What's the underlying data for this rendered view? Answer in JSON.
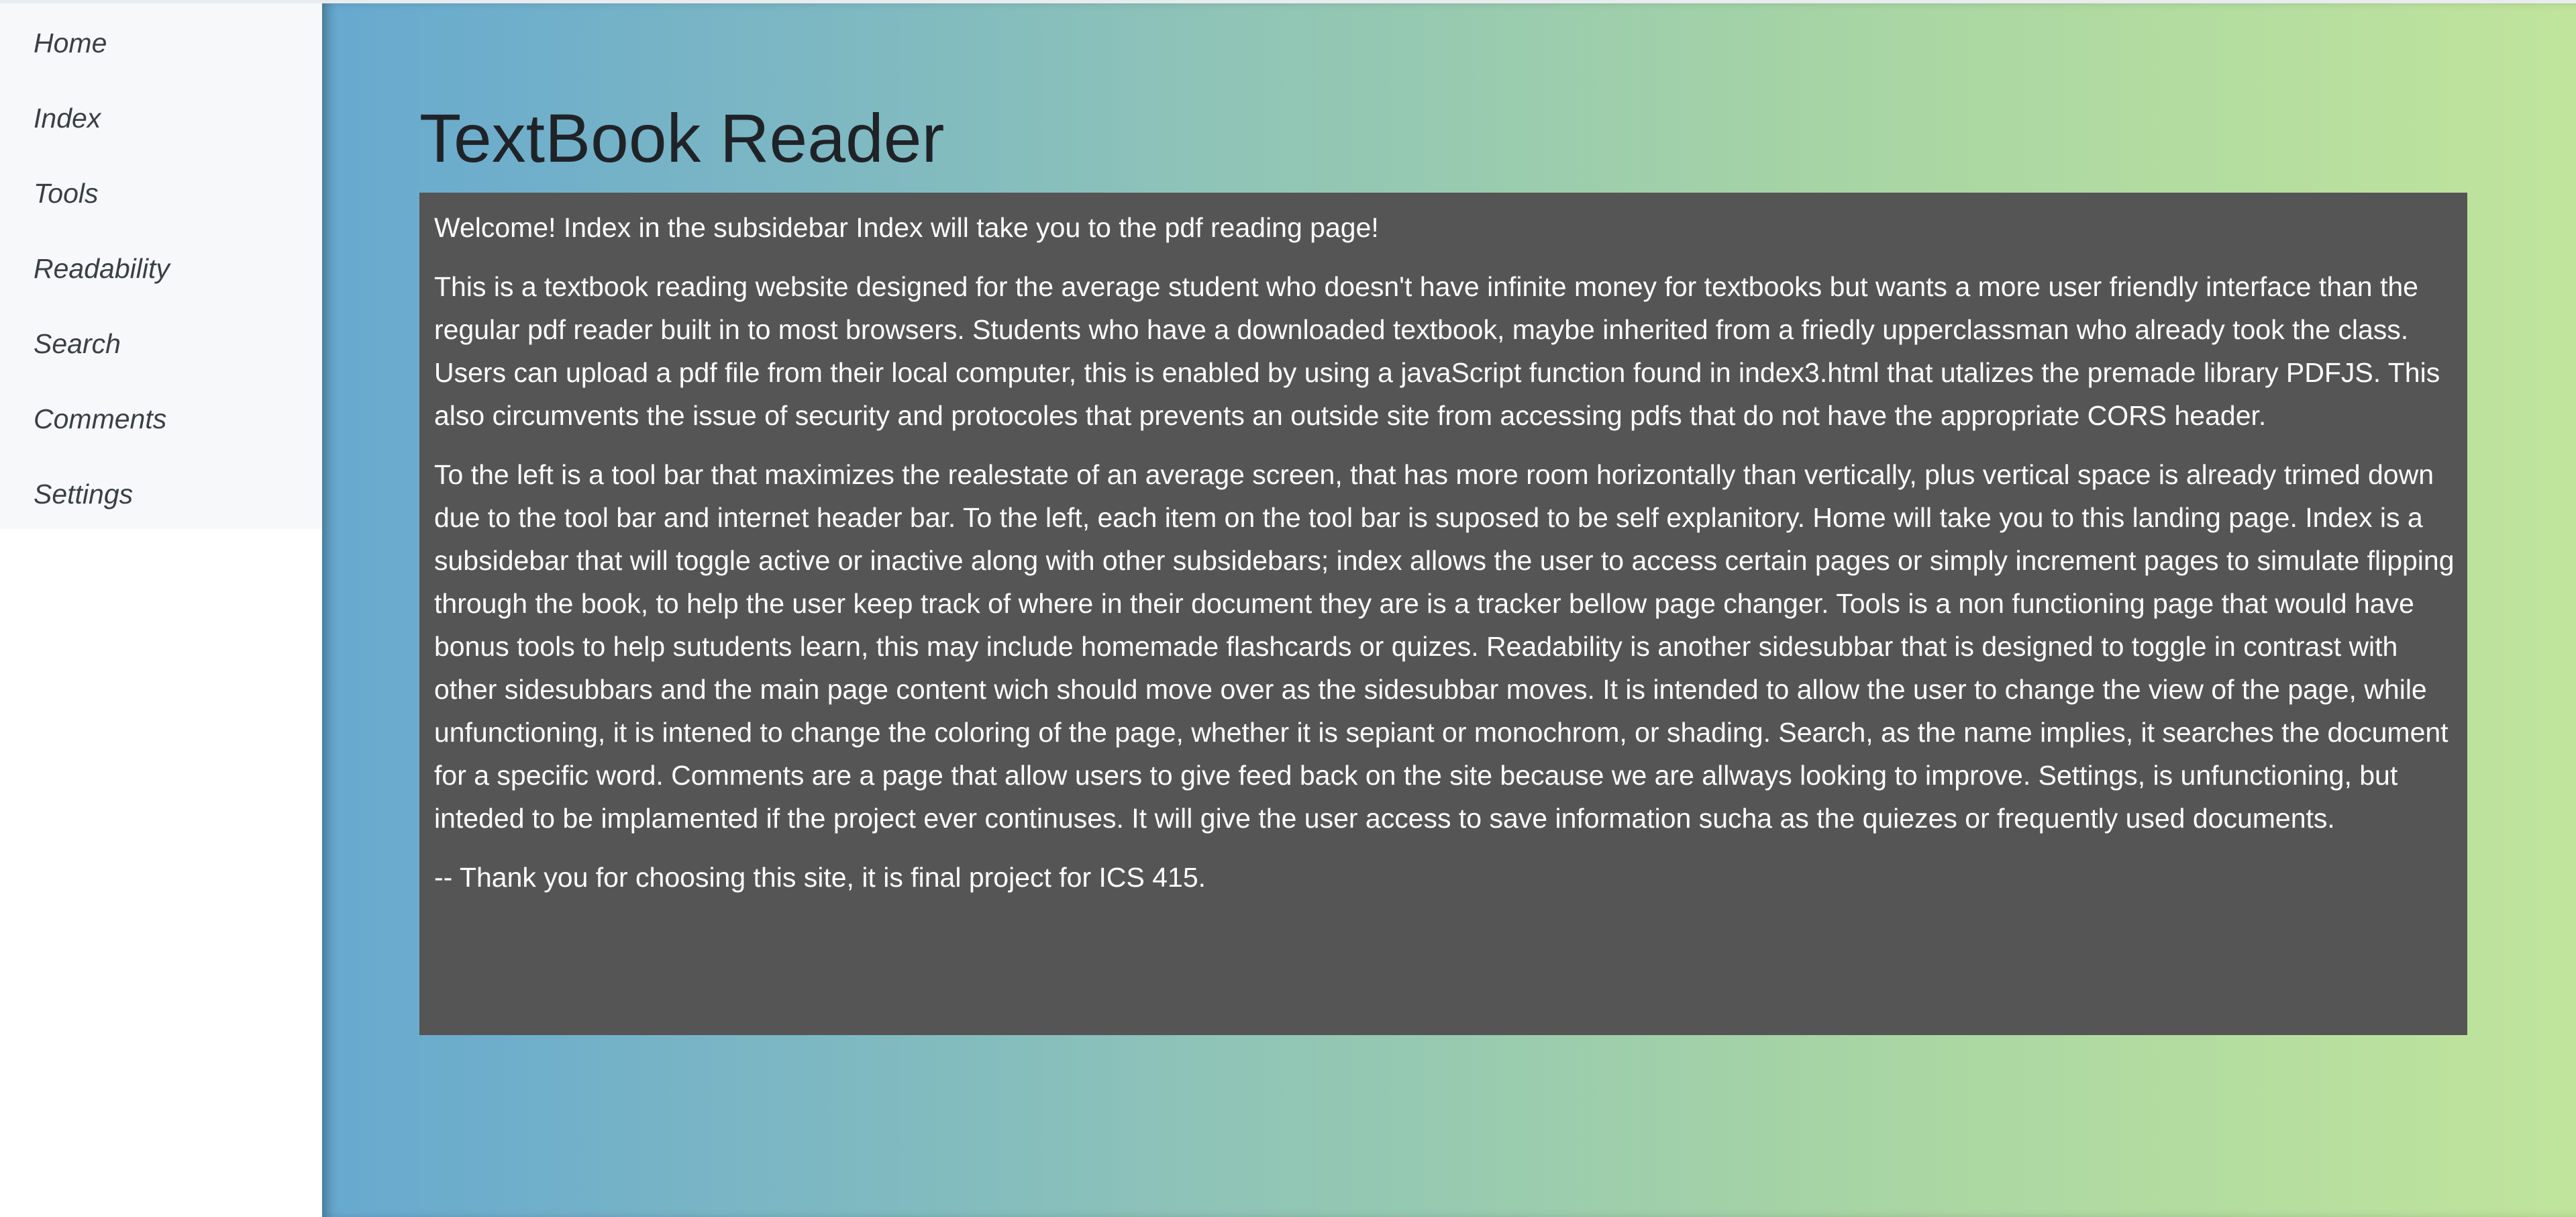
{
  "sidebar": {
    "items": [
      {
        "label": "Home"
      },
      {
        "label": "Index"
      },
      {
        "label": "Tools"
      },
      {
        "label": "Readability"
      },
      {
        "label": "Search"
      },
      {
        "label": "Comments"
      },
      {
        "label": "Settings"
      }
    ]
  },
  "main": {
    "title": "TextBook Reader",
    "paragraphs": [
      "Welcome! Index in the subsidebar Index will take you to the pdf reading page!",
      "This is a textbook reading website designed for the average student who doesn't have infinite money for textbooks but wants a more user friendly interface than the regular pdf reader built in to most browsers. Students who have a downloaded textbook, maybe inherited from a friedly upperclassman who already took the class. Users can upload a pdf file from their local computer, this is enabled by using a javaScript function found in index3.html that utalizes the premade library PDFJS. This also circumvents the issue of security and protocoles that prevents an outside site from accessing pdfs that do not have the appropriate CORS header.",
      "To the left is a tool bar that maximizes the realestate of an average screen, that has more room horizontally than vertically, plus vertical space is already trimed down due to the tool bar and internet header bar. To the left, each item on the tool bar is suposed to be self explanitory. Home will take you to this landing page. Index is a subsidebar that will toggle active or inactive along with other subsidebars; index allows the user to access certain pages or simply increment pages to simulate flipping through the book, to help the user keep track of where in their document they are is a tracker bellow page changer. Tools is a non functioning page that would have bonus tools to help sutudents learn, this may include homemade flashcards or quizes. Readability is another sidesubbar that is designed to toggle in contrast with other sidesubbars and the main page content wich should move over as the sidesubbar moves. It is intended to allow the user to change the view of the page, while unfunctioning, it is intened to change the coloring of the page, whether it is sepiant or monochrom, or shading. Search, as the name implies, it searches the document for a specific word. Comments are a page that allow users to give feed back on the site because we are allways looking to improve. Settings, is unfunctioning, but inteded to be implamented if the project ever continuses. It will give the user access to save information sucha as the quiezes or frequently used documents.",
      "-- Thank you for choosing this site, it is final project for ICS 415."
    ]
  }
}
